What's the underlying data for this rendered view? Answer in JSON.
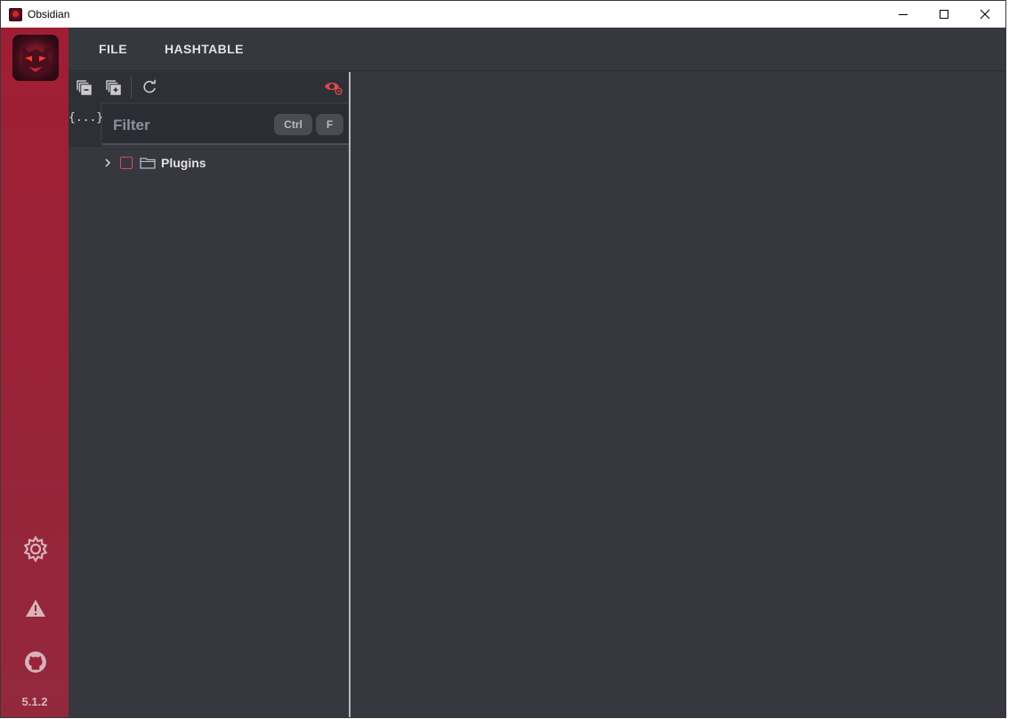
{
  "window": {
    "title": "Obsidian",
    "icon": "obsidian-app-icon",
    "controls": [
      "minimize-icon",
      "maximize-icon",
      "close-icon"
    ]
  },
  "sidebar": {
    "logo": "demon-logo",
    "icons": [
      "gear-icon",
      "warning-icon",
      "github-icon"
    ],
    "version": "5.1.2",
    "color": "#a01e33"
  },
  "menu": {
    "file_label": "FILE",
    "hashtable_label": "HASHTABLE"
  },
  "toolbar": {
    "icons": [
      "collapse-all-icon",
      "expand-all-icon",
      "refresh-icon",
      "visibility-icon"
    ]
  },
  "explorer": {
    "braces_label": "{...}",
    "filter_placeholder": "Filter",
    "shortcut_keys": [
      "Ctrl",
      "F"
    ],
    "tree": [
      {
        "label": "Plugins",
        "expanded": false,
        "checked": false,
        "icon": "folder-icon"
      }
    ]
  },
  "colors": {
    "background": "#36373f",
    "panel_toolbar": "#2f3037",
    "accent_red": "#e2474f"
  }
}
